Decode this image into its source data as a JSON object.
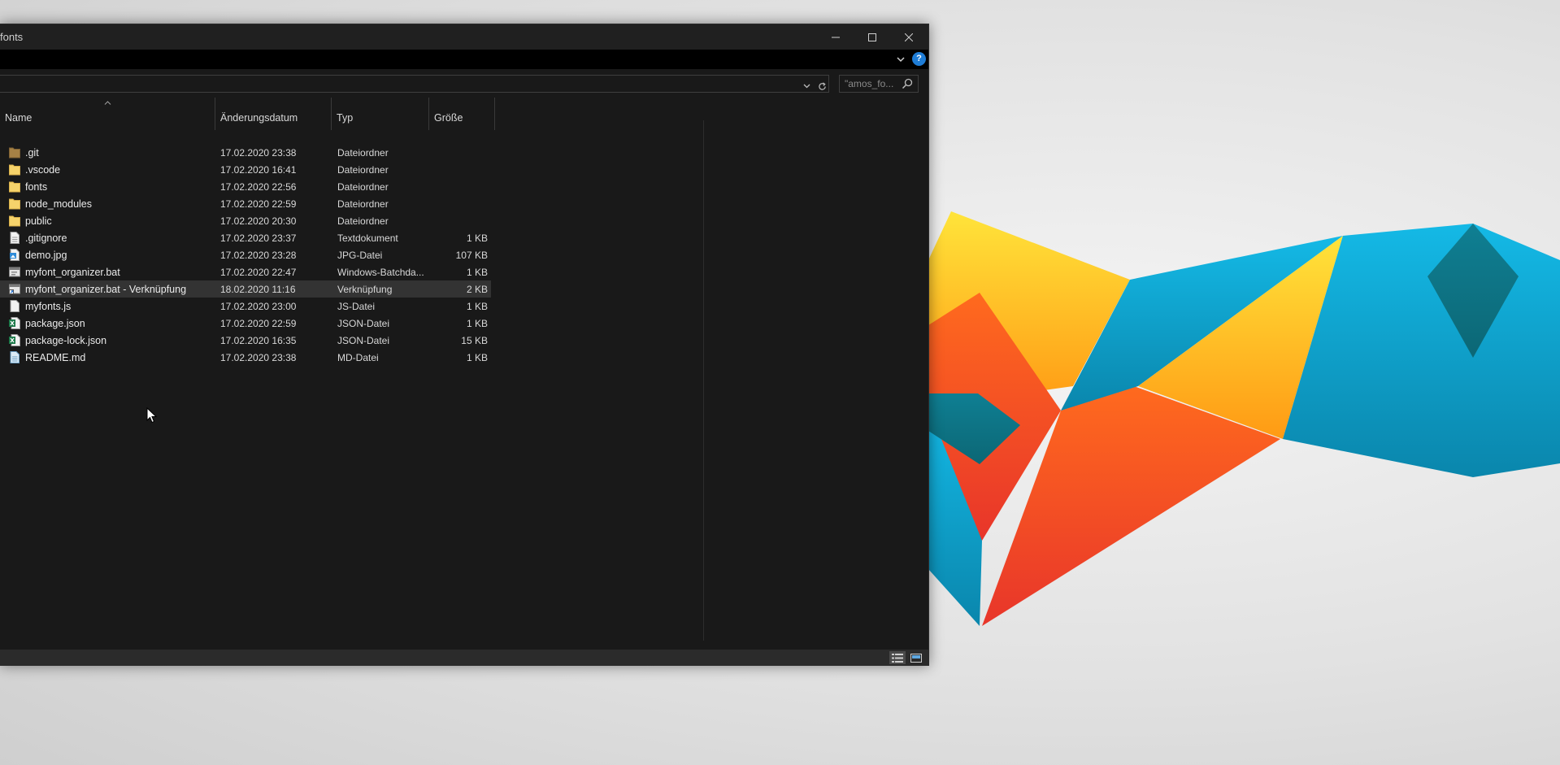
{
  "window": {
    "title": "fonts"
  },
  "search": {
    "placeholder": "\"amos_fo..."
  },
  "columns": {
    "name": "Name",
    "date": "Änderungsdatum",
    "type": "Typ",
    "size": "Größe"
  },
  "files": [
    {
      "name": ".git",
      "date": "17.02.2020 23:38",
      "type": "Dateiordner",
      "size": "",
      "icon": "folder-dark-icon"
    },
    {
      "name": ".vscode",
      "date": "17.02.2020 16:41",
      "type": "Dateiordner",
      "size": "",
      "icon": "folder-icon"
    },
    {
      "name": "fonts",
      "date": "17.02.2020 22:56",
      "type": "Dateiordner",
      "size": "",
      "icon": "folder-icon"
    },
    {
      "name": "node_modules",
      "date": "17.02.2020 22:59",
      "type": "Dateiordner",
      "size": "",
      "icon": "folder-icon"
    },
    {
      "name": "public",
      "date": "17.02.2020 20:30",
      "type": "Dateiordner",
      "size": "",
      "icon": "folder-icon"
    },
    {
      "name": ".gitignore",
      "date": "17.02.2020 23:37",
      "type": "Textdokument",
      "size": "1 KB",
      "icon": "text-file-icon"
    },
    {
      "name": "demo.jpg",
      "date": "17.02.2020 23:28",
      "type": "JPG-Datei",
      "size": "107 KB",
      "icon": "image-file-icon"
    },
    {
      "name": "myfont_organizer.bat",
      "date": "17.02.2020 22:47",
      "type": "Windows-Batchda...",
      "size": "1 KB",
      "icon": "batch-file-icon"
    },
    {
      "name": "myfont_organizer.bat - Verknüpfung",
      "date": "18.02.2020 11:16",
      "type": "Verknüpfung",
      "size": "2 KB",
      "icon": "shortcut-icon"
    },
    {
      "name": "myfonts.js",
      "date": "17.02.2020 23:00",
      "type": "JS-Datei",
      "size": "1 KB",
      "icon": "js-file-icon"
    },
    {
      "name": "package.json",
      "date": "17.02.2020 22:59",
      "type": "JSON-Datei",
      "size": "1 KB",
      "icon": "json-file-icon"
    },
    {
      "name": "package-lock.json",
      "date": "17.02.2020 16:35",
      "type": "JSON-Datei",
      "size": "15 KB",
      "icon": "json-file-icon"
    },
    {
      "name": "README.md",
      "date": "17.02.2020 23:38",
      "type": "MD-Datei",
      "size": "1 KB",
      "icon": "md-file-icon"
    }
  ],
  "selected_row": 8,
  "colors": {
    "window_bg": "#191919",
    "titlebar_bg": "#202020",
    "accent": "#1f7dd6",
    "selection": "#333333"
  }
}
